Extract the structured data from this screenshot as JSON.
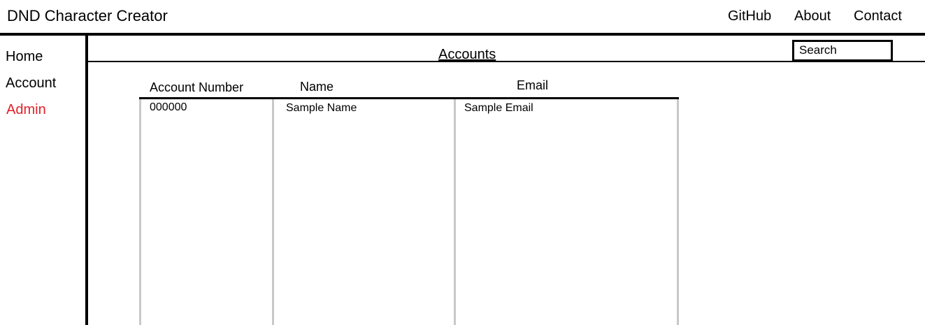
{
  "header": {
    "title": "DND Character Creator",
    "nav": [
      {
        "label": "GitHub"
      },
      {
        "label": "About"
      },
      {
        "label": "Contact"
      }
    ]
  },
  "sidebar": {
    "items": [
      {
        "label": "Home"
      },
      {
        "label": "Account"
      },
      {
        "label": "Admin",
        "color": "#e0202a",
        "active": true
      }
    ]
  },
  "main": {
    "title": "Accounts",
    "search": {
      "label": "Search"
    },
    "table": {
      "columns": [
        "Account Number",
        "Name",
        "Email"
      ],
      "rows": [
        [
          "000000",
          "Sample Name",
          "Sample Email"
        ]
      ]
    }
  },
  "colors": {
    "text": "#000000",
    "active_link": "#e0202a",
    "column_lines": "#c8c8c8"
  }
}
